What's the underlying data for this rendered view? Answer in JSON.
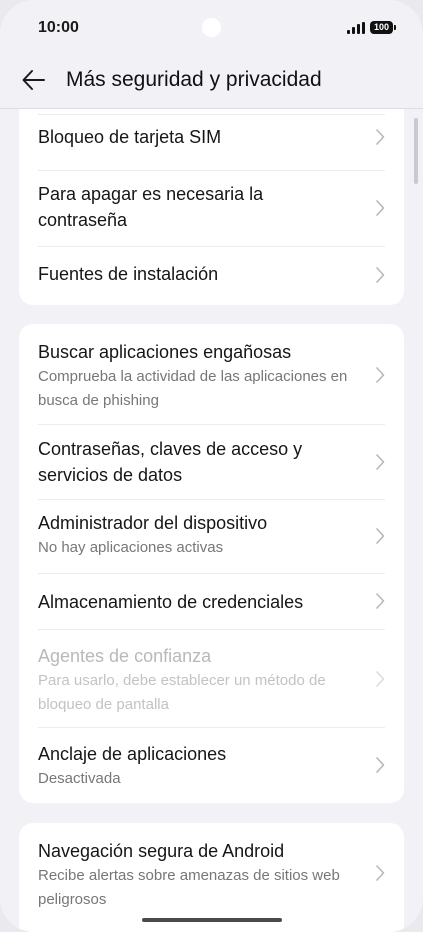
{
  "status_bar": {
    "time": "10:00",
    "battery": "100"
  },
  "app_bar": {
    "title": "Más seguridad y privacidad"
  },
  "card1": {
    "items": [
      {
        "title": "Bloqueo de tarjeta SIM"
      },
      {
        "title": "Para apagar es necesaria la contraseña"
      },
      {
        "title": "Fuentes de instalación"
      }
    ]
  },
  "card2": {
    "items": [
      {
        "title": "Buscar aplicaciones engañosas",
        "subtitle": "Comprueba la actividad de las aplicaciones en busca de phishing"
      },
      {
        "title": "Contraseñas, claves de acceso y servicios de datos"
      },
      {
        "title": "Administrador del dispositivo",
        "subtitle": "No hay aplicaciones activas"
      },
      {
        "title": "Almacenamiento de credenciales"
      },
      {
        "title": "Agentes de confianza",
        "subtitle": "Para usarlo, debe establecer un método de bloqueo de pantalla"
      },
      {
        "title": "Anclaje de aplicaciones",
        "subtitle": "Desactivada"
      }
    ]
  },
  "card3": {
    "items": [
      {
        "title": "Navegación segura de Android",
        "subtitle": "Recibe alertas sobre amenazas de sitios web peligrosos"
      }
    ]
  }
}
